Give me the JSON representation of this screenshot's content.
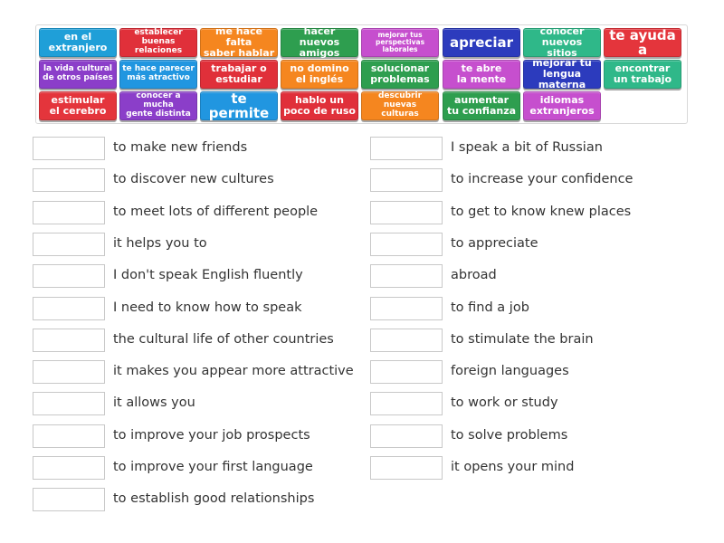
{
  "tiles": [
    {
      "text": "en el\nextranjero",
      "color": "#1f9fd8"
    },
    {
      "text": "establecer\nbuenas relaciones",
      "color": "#e0303a"
    },
    {
      "text": "me hace falta\nsaber hablar",
      "color": "#f5861f"
    },
    {
      "text": "hacer nuevos\namigos",
      "color": "#2e9e4f"
    },
    {
      "text": "mejorar tus\nperspectivas\nlaborales",
      "color": "#c64fce"
    },
    {
      "text": "apreciar",
      "color": "#2c3bbd"
    },
    {
      "text": "conocer\nnuevos sitios",
      "color": "#2fb889"
    },
    {
      "text": "te ayuda a",
      "color": "#e4353c"
    },
    {
      "text": "la vida cultural\nde otros países",
      "color": "#8b3ec9"
    },
    {
      "text": "te hace parecer\nmás atractivo",
      "color": "#2196e0"
    },
    {
      "text": "trabajar o\nestudiar",
      "color": "#e0303a"
    },
    {
      "text": "no domino\nel inglés",
      "color": "#f5861f"
    },
    {
      "text": "solucionar\nproblemas",
      "color": "#2e9e4f"
    },
    {
      "text": "te abre\nla mente",
      "color": "#c64fce"
    },
    {
      "text": "mejorar tu\nlengua materna",
      "color": "#2c3bbd"
    },
    {
      "text": "encontrar\nun trabajo",
      "color": "#2fb889"
    },
    {
      "text": "estimular\nel cerebro",
      "color": "#e4353c"
    },
    {
      "text": "conocer a mucha\ngente distinta",
      "color": "#8b3ec9"
    },
    {
      "text": "te permite",
      "color": "#2196e0"
    },
    {
      "text": "hablo un\npoco de ruso",
      "color": "#e0303a"
    },
    {
      "text": "descubrir\nnuevas culturas",
      "color": "#f5861f"
    },
    {
      "text": "aumentar\ntu confianza",
      "color": "#2e9e4f"
    },
    {
      "text": "idiomas\nextranjeros",
      "color": "#c64fce"
    }
  ],
  "left_prompts": [
    "to make new friends",
    "to discover new cultures",
    "to meet lots of different people",
    "it helps you to",
    "I don't speak English fluently",
    "I need to know how to speak",
    "the cultural life of other countries",
    "it makes you appear more attractive",
    "it allows you",
    "to improve your job prospects",
    "to improve your first language",
    "to establish good relationships"
  ],
  "right_prompts": [
    "I speak a bit of Russian",
    "to increase your confidence",
    "to get to know knew places",
    "to appreciate",
    "abroad",
    "to find a job",
    "to stimulate the brain",
    "foreign languages",
    "to work or study",
    "to solve problems",
    "it opens your mind"
  ]
}
